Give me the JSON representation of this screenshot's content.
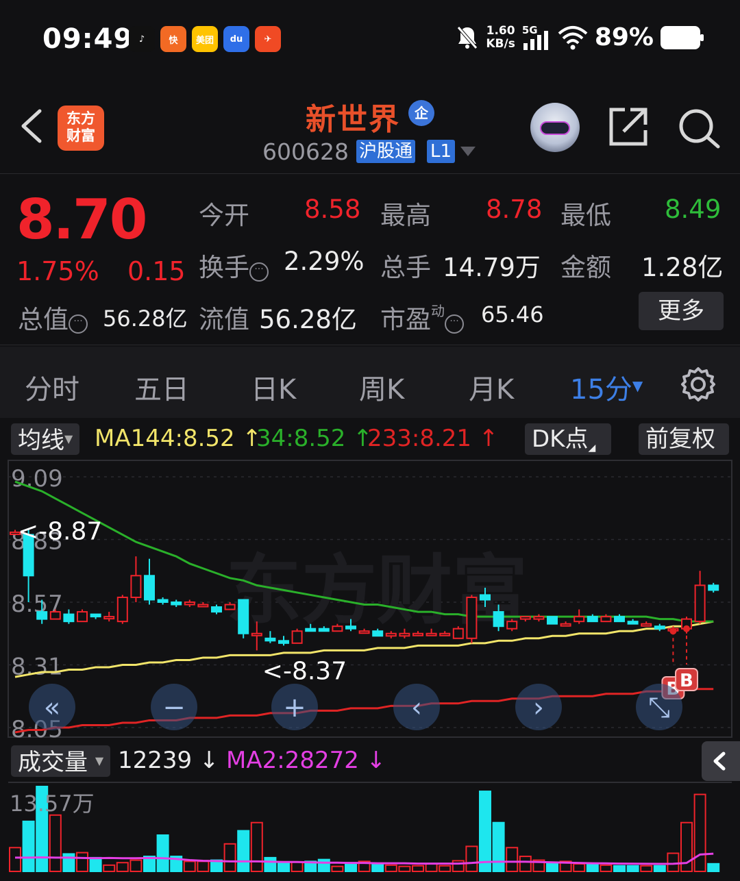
{
  "status_bar": {
    "time": "09:49",
    "apps": [
      {
        "name": "douyin-icon",
        "label": "♪",
        "color": "#111111"
      },
      {
        "name": "kuaishou-icon",
        "label": "快",
        "color": "#f26a24"
      },
      {
        "name": "meituan-icon",
        "label": "美团",
        "color": "#ffc300"
      },
      {
        "name": "baidu-icon",
        "label": "du",
        "color": "#2f6fe8"
      },
      {
        "name": "feather-app-icon",
        "label": "✈",
        "color": "#f04a24"
      }
    ],
    "net_speed_value": "1.60",
    "net_speed_unit": "KB/s",
    "network": "5G",
    "battery": "89%"
  },
  "header": {
    "brand_line1": "东方",
    "brand_line2": "财富",
    "stock_name": "新世界",
    "enterprise_badge": "企",
    "stock_code": "600628",
    "tag_hgt": "沪股通",
    "tag_level": "L1"
  },
  "quote": {
    "price": "8.70",
    "change_pct": "1.75%",
    "change_abs": "0.15",
    "open_label": "今开",
    "open": "8.58",
    "high_label": "最高",
    "high": "8.78",
    "low_label": "最低",
    "low": "8.49",
    "turnover_label": "换手",
    "turnover": "2.29%",
    "volume_label": "总手",
    "volume": "14.79万",
    "amount_label": "金额",
    "amount": "1.28亿",
    "mktcap_label": "总值",
    "mktcap": "56.28亿",
    "float_label": "流值",
    "float_cap": "56.28亿",
    "pe_label": "市盈",
    "pe_sup": "动",
    "pe": "65.46",
    "more_label": "更多"
  },
  "tabs": [
    {
      "label": "分时",
      "active": false
    },
    {
      "label": "五日",
      "active": false
    },
    {
      "label": "日K",
      "active": false
    },
    {
      "label": "周K",
      "active": false
    },
    {
      "label": "月K",
      "active": false
    },
    {
      "label": "15分",
      "active": true
    }
  ],
  "indicators": {
    "ma_selector": "均线",
    "ma144": "MA144:8.52",
    "ma34": "34:8.52",
    "ma233": "233:8.21",
    "up_arrow": "↑",
    "dk_label": "DK点",
    "adjust_label": "前复权"
  },
  "colors": {
    "up": "#f0232b",
    "down": "#1ee6ee",
    "ma144": "#f2e56a",
    "ma34": "#2ab02a",
    "ma233": "#e02424"
  },
  "chart_data": {
    "type": "candlestick",
    "period": "15分",
    "y_ticks": [
      "9.09",
      "8.83",
      "8.57",
      "8.31",
      "8.05"
    ],
    "y_range": [
      8.05,
      9.09
    ],
    "annotations": {
      "max": "<-8.87",
      "min": "<-8.37"
    },
    "candles": [
      {
        "o": 8.86,
        "h": 8.87,
        "l": 8.85,
        "c": 8.86
      },
      {
        "o": 8.85,
        "h": 8.87,
        "l": 8.57,
        "c": 8.68
      },
      {
        "o": 8.53,
        "h": 8.58,
        "l": 8.48,
        "c": 8.5
      },
      {
        "o": 8.5,
        "h": 8.54,
        "l": 8.5,
        "c": 8.53
      },
      {
        "o": 8.52,
        "h": 8.54,
        "l": 8.48,
        "c": 8.49
      },
      {
        "o": 8.49,
        "h": 8.54,
        "l": 8.49,
        "c": 8.53
      },
      {
        "o": 8.52,
        "h": 8.52,
        "l": 8.5,
        "c": 8.51
      },
      {
        "o": 8.51,
        "h": 8.53,
        "l": 8.49,
        "c": 8.51
      },
      {
        "o": 8.49,
        "h": 8.6,
        "l": 8.48,
        "c": 8.59
      },
      {
        "o": 8.59,
        "h": 8.76,
        "l": 8.57,
        "c": 8.68
      },
      {
        "o": 8.68,
        "h": 8.75,
        "l": 8.56,
        "c": 8.58
      },
      {
        "o": 8.58,
        "h": 8.59,
        "l": 8.56,
        "c": 8.57
      },
      {
        "o": 8.57,
        "h": 8.58,
        "l": 8.55,
        "c": 8.56
      },
      {
        "o": 8.56,
        "h": 8.58,
        "l": 8.55,
        "c": 8.57
      },
      {
        "o": 8.56,
        "h": 8.57,
        "l": 8.55,
        "c": 8.56
      },
      {
        "o": 8.55,
        "h": 8.56,
        "l": 8.52,
        "c": 8.53
      },
      {
        "o": 8.54,
        "h": 8.57,
        "l": 8.54,
        "c": 8.56
      },
      {
        "o": 8.58,
        "h": 8.58,
        "l": 8.42,
        "c": 8.44
      },
      {
        "o": 8.44,
        "h": 8.49,
        "l": 8.37,
        "c": 8.44
      },
      {
        "o": 8.42,
        "h": 8.45,
        "l": 8.4,
        "c": 8.41
      },
      {
        "o": 8.41,
        "h": 8.43,
        "l": 8.39,
        "c": 8.4
      },
      {
        "o": 8.4,
        "h": 8.46,
        "l": 8.4,
        "c": 8.45
      },
      {
        "o": 8.46,
        "h": 8.48,
        "l": 8.45,
        "c": 8.45
      },
      {
        "o": 8.46,
        "h": 8.47,
        "l": 8.45,
        "c": 8.45
      },
      {
        "o": 8.45,
        "h": 8.48,
        "l": 8.45,
        "c": 8.47
      },
      {
        "o": 8.47,
        "h": 8.5,
        "l": 8.45,
        "c": 8.46
      },
      {
        "o": 8.45,
        "h": 8.46,
        "l": 8.44,
        "c": 8.45
      },
      {
        "o": 8.45,
        "h": 8.46,
        "l": 8.43,
        "c": 8.43
      },
      {
        "o": 8.43,
        "h": 8.45,
        "l": 8.42,
        "c": 8.44
      },
      {
        "o": 8.43,
        "h": 8.46,
        "l": 8.42,
        "c": 8.44
      },
      {
        "o": 8.44,
        "h": 8.45,
        "l": 8.43,
        "c": 8.44
      },
      {
        "o": 8.44,
        "h": 8.46,
        "l": 8.43,
        "c": 8.44
      },
      {
        "o": 8.44,
        "h": 8.45,
        "l": 8.43,
        "c": 8.44
      },
      {
        "o": 8.42,
        "h": 8.47,
        "l": 8.42,
        "c": 8.46
      },
      {
        "o": 8.42,
        "h": 8.6,
        "l": 8.4,
        "c": 8.59
      },
      {
        "o": 8.6,
        "h": 8.63,
        "l": 8.55,
        "c": 8.58
      },
      {
        "o": 8.53,
        "h": 8.56,
        "l": 8.45,
        "c": 8.47
      },
      {
        "o": 8.46,
        "h": 8.5,
        "l": 8.45,
        "c": 8.49
      },
      {
        "o": 8.5,
        "h": 8.51,
        "l": 8.49,
        "c": 8.51
      },
      {
        "o": 8.5,
        "h": 8.52,
        "l": 8.49,
        "c": 8.51
      },
      {
        "o": 8.51,
        "h": 8.51,
        "l": 8.48,
        "c": 8.48
      },
      {
        "o": 8.48,
        "h": 8.49,
        "l": 8.47,
        "c": 8.48
      },
      {
        "o": 8.49,
        "h": 8.54,
        "l": 8.48,
        "c": 8.51
      },
      {
        "o": 8.51,
        "h": 8.52,
        "l": 8.49,
        "c": 8.49
      },
      {
        "o": 8.49,
        "h": 8.52,
        "l": 8.49,
        "c": 8.51
      },
      {
        "o": 8.51,
        "h": 8.52,
        "l": 8.49,
        "c": 8.49
      },
      {
        "o": 8.49,
        "h": 8.5,
        "l": 8.48,
        "c": 8.48
      },
      {
        "o": 8.48,
        "h": 8.49,
        "l": 8.47,
        "c": 8.48
      },
      {
        "o": 8.47,
        "h": 8.48,
        "l": 8.45,
        "c": 8.46
      },
      {
        "o": 8.46,
        "h": 8.47,
        "l": 8.45,
        "c": 8.46
      },
      {
        "o": 8.46,
        "h": 8.51,
        "l": 8.44,
        "c": 8.5
      },
      {
        "o": 8.49,
        "h": 8.7,
        "l": 8.48,
        "c": 8.64
      },
      {
        "o": 8.64,
        "h": 8.65,
        "l": 8.61,
        "c": 8.62
      }
    ],
    "ma144": [
      8.26,
      8.27,
      8.28,
      8.28,
      8.29,
      8.29,
      8.3,
      8.3,
      8.31,
      8.31,
      8.32,
      8.32,
      8.33,
      8.33,
      8.34,
      8.34,
      8.35,
      8.35,
      8.35,
      8.35,
      8.36,
      8.36,
      8.36,
      8.37,
      8.37,
      8.37,
      8.37,
      8.38,
      8.38,
      8.38,
      8.39,
      8.39,
      8.39,
      8.39,
      8.4,
      8.4,
      8.41,
      8.41,
      8.42,
      8.42,
      8.43,
      8.43,
      8.44,
      8.44,
      8.44,
      8.45,
      8.45,
      8.46,
      8.46,
      8.47,
      8.47,
      8.48,
      8.49
    ],
    "ma34": [
      9.07,
      9.05,
      9.03,
      9.0,
      8.97,
      8.94,
      8.91,
      8.88,
      8.85,
      8.82,
      8.8,
      8.78,
      8.76,
      8.73,
      8.71,
      8.69,
      8.67,
      8.66,
      8.64,
      8.63,
      8.62,
      8.61,
      8.6,
      8.59,
      8.58,
      8.57,
      8.56,
      8.56,
      8.55,
      8.54,
      8.53,
      8.53,
      8.52,
      8.52,
      8.51,
      8.51,
      8.51,
      8.51,
      8.51,
      8.51,
      8.51,
      8.51,
      8.51,
      8.51,
      8.51,
      8.51,
      8.51,
      8.51,
      8.5,
      8.5,
      8.49,
      8.49,
      8.49
    ],
    "ma233": [
      8.03,
      8.04,
      8.04,
      8.05,
      8.05,
      8.06,
      8.06,
      8.06,
      8.07,
      8.07,
      8.08,
      8.08,
      8.08,
      8.09,
      8.09,
      8.09,
      8.1,
      8.1,
      8.1,
      8.11,
      8.11,
      8.11,
      8.12,
      8.12,
      8.12,
      8.13,
      8.13,
      8.13,
      8.14,
      8.14,
      8.14,
      8.15,
      8.15,
      8.15,
      8.16,
      8.16,
      8.16,
      8.17,
      8.17,
      8.17,
      8.18,
      8.18,
      8.18,
      8.18,
      8.19,
      8.19,
      8.19,
      8.2,
      8.2,
      8.2,
      8.21,
      8.21,
      8.21
    ],
    "buy_marker": "B",
    "volume": {
      "label": "成交量",
      "current": "12239",
      "current_arrow": "↓",
      "ma2": "MA2:28272",
      "ma2_arrow": "↓",
      "max_tick": "13.57万",
      "y_max": 135700,
      "bars": [
        38000,
        80000,
        135700,
        90000,
        28000,
        30000,
        22000,
        10000,
        14000,
        18000,
        24000,
        58000,
        24000,
        16000,
        16000,
        18000,
        44000,
        65000,
        78000,
        22000,
        13000,
        15000,
        16000,
        19000,
        8000,
        14000,
        16000,
        12000,
        10000,
        8000,
        9000,
        12000,
        9000,
        17000,
        40000,
        128000,
        78000,
        38000,
        24000,
        18000,
        14000,
        16000,
        12000,
        11000,
        10000,
        9000,
        9000,
        9000,
        9000,
        29000,
        78000,
        123000,
        12239
      ],
      "ma2_line": [
        22000,
        22000,
        22500,
        22000,
        22000,
        21500,
        21000,
        21500,
        21000,
        21000,
        21500,
        21000,
        20000,
        18000,
        17000,
        16500,
        16000,
        16000,
        16000,
        15500,
        15000,
        15000,
        14500,
        14000,
        14000,
        13500,
        13500,
        13000,
        13000,
        13000,
        12500,
        12500,
        12500,
        12500,
        13500,
        15000,
        15500,
        15500,
        15500,
        15000,
        14500,
        14000,
        13500,
        13000,
        12800,
        12500,
        12300,
        12200,
        12100,
        12200,
        13500,
        27000,
        28272
      ]
    }
  },
  "nav_buttons": [
    "«",
    "−",
    "+",
    "‹",
    "›",
    "⤡"
  ]
}
